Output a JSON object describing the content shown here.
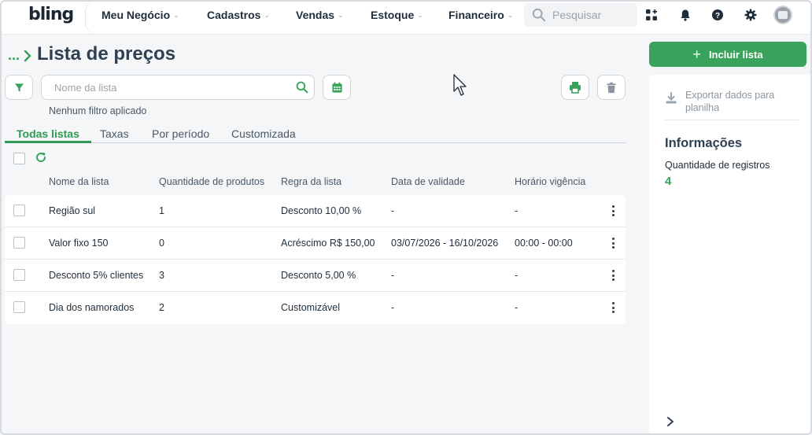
{
  "app": {
    "logo": "bling",
    "nav": [
      {
        "label": "Meu Negócio",
        "name": "nav-meu-negocio"
      },
      {
        "label": "Cadastros",
        "name": "nav-cadastros"
      },
      {
        "label": "Vendas",
        "name": "nav-vendas"
      },
      {
        "label": "Estoque",
        "name": "nav-estoque"
      },
      {
        "label": "Financeiro",
        "name": "nav-financeiro"
      }
    ],
    "search_placeholder": "Pesquisar",
    "icons": [
      "apps-icon",
      "bell-icon",
      "help-icon",
      "gear-icon",
      "avatar"
    ]
  },
  "page": {
    "breadcrumb": "...",
    "title": "Lista de preços",
    "search_placeholder": "Nome da lista",
    "filter_status": "Nenhum filtro aplicado",
    "tabs": [
      "Todas listas",
      "Taxas",
      "Por período",
      "Customizada"
    ],
    "active_tab": 0
  },
  "table": {
    "columns": [
      "Nome da lista",
      "Quantidade de produtos",
      "Regra da lista",
      "Data de validade",
      "Horário vigência"
    ],
    "rows": [
      {
        "nome": "Região sul",
        "qtd": "1",
        "regra": "Desconto 10,00 %",
        "data": "-",
        "horario": "-"
      },
      {
        "nome": "Valor fixo 150",
        "qtd": "0",
        "regra": "Acréscimo R$ 150,00",
        "data": "03/07/2026 - 16/10/2026",
        "horario": "00:00 - 00:00"
      },
      {
        "nome": "Desconto 5% clientes",
        "qtd": "3",
        "regra": "Desconto 5,00 %",
        "data": "-",
        "horario": "-"
      },
      {
        "nome": "Dia dos namorados",
        "qtd": "2",
        "regra": "Customizável",
        "data": "-",
        "horario": "-"
      }
    ]
  },
  "sidebar": {
    "primary_button": "Incluir lista",
    "export_label": "Exportar dados para planilha",
    "info_title": "Informações",
    "records_label": "Quantidade de registros",
    "records_value": "4"
  },
  "colors": {
    "accent": "#3aa35b",
    "title": "#2f4052",
    "background": "#f4f6f8"
  }
}
